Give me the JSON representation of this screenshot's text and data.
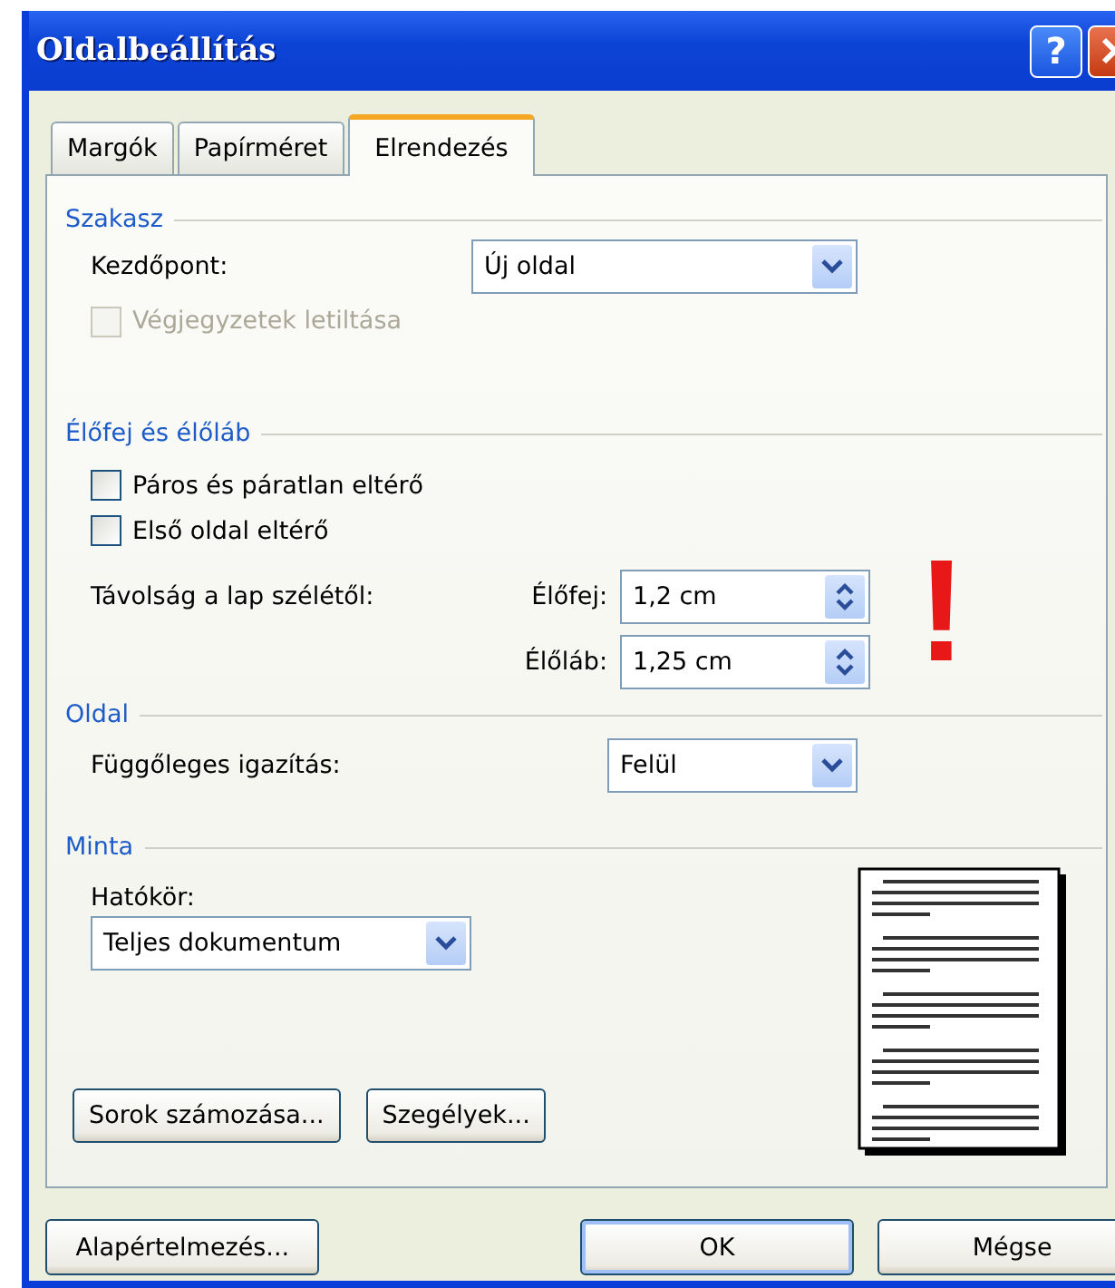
{
  "window": {
    "title": "Oldalbeállítás"
  },
  "title_buttons": [
    {
      "kind": "help",
      "label": "?"
    },
    {
      "kind": "close"
    }
  ],
  "tabs": [
    {
      "label": "Margók",
      "selected": false
    },
    {
      "label": "Papírméret",
      "selected": false
    },
    {
      "label": "Elrendezés",
      "selected": true
    }
  ],
  "section_start": {
    "title": "Szakasz",
    "start_label": "Kezdőpont:",
    "start_value": "Új oldal",
    "endnotes": {
      "label": "Végjegyzetek letiltása",
      "checked": false,
      "disabled": true
    }
  },
  "section_headers": {
    "title": "Élőfej és élőláb",
    "checkboxes": [
      {
        "label": "Páros és páratlan eltérő",
        "checked": false,
        "disabled": false
      },
      {
        "label": "Első oldal eltérő",
        "checked": false,
        "disabled": false
      }
    ],
    "distance_label": "Távolság a lap szélétől:",
    "spinners": [
      {
        "label": "Élőfej:",
        "value": "1,2 cm"
      },
      {
        "label": "Élőláb:",
        "value": "1,25 cm"
      }
    ]
  },
  "annotation": "!",
  "section_page": {
    "title": "Oldal",
    "align_label": "Függőleges igazítás:",
    "align_value": "Felül"
  },
  "section_preview": {
    "title": "Minta",
    "scope_label": "Hatókör:",
    "scope_value": "Teljes dokumentum",
    "buttons": [
      "Sorok számozása...",
      "Szegélyek..."
    ]
  },
  "footer_buttons": [
    {
      "label": "Alapértelmezés...",
      "default": false
    },
    {
      "label": "OK",
      "default": true
    },
    {
      "label": "Mégse",
      "default": false
    }
  ]
}
